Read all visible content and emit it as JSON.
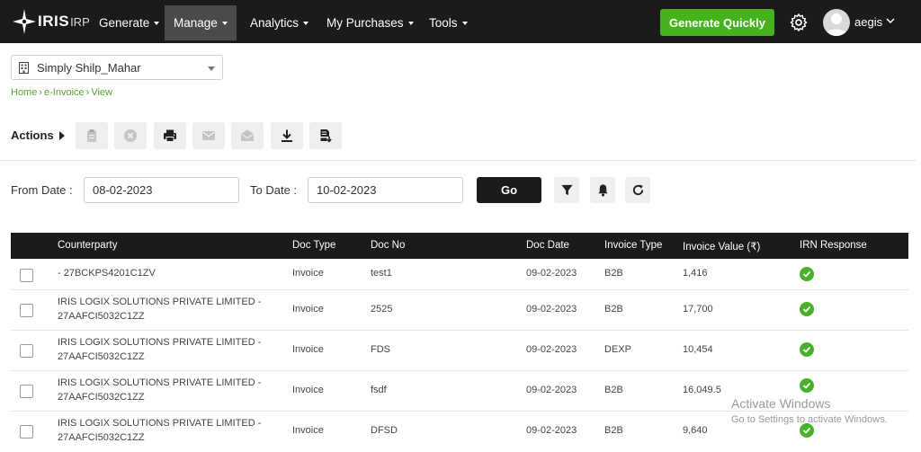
{
  "brand": {
    "name": "IRIS",
    "suffix": "IRP"
  },
  "nav": [
    {
      "label": "Generate"
    },
    {
      "label": "Manage"
    },
    {
      "label": "Analytics"
    },
    {
      "label": "My Purchases"
    },
    {
      "label": "Tools"
    }
  ],
  "header": {
    "cta_label": "Generate Quickly",
    "user_name": "aegis"
  },
  "company": {
    "selected": "Simply Shilp_Mahar"
  },
  "breadcrumb": {
    "home": "Home",
    "sep1": "›",
    "einvoice": "e-Invoice",
    "sep2": "›",
    "view": "View"
  },
  "actions": {
    "label": "Actions"
  },
  "filters": {
    "from_label": "From Date :",
    "from_value": "08-02-2023",
    "to_label": "To Date :",
    "to_value": "10-02-2023",
    "go_label": "Go"
  },
  "table": {
    "columns": [
      "Counterparty",
      "Doc Type",
      "Doc No",
      "Doc Date",
      "Invoice Type",
      "Invoice Value (₹)",
      "IRN Response"
    ],
    "rows": [
      {
        "cp1": "- 27BCKPS4201C1ZV",
        "cp2": "",
        "doc_type": "Invoice",
        "doc_no": "test1",
        "doc_date": "09-02-2023",
        "inv_type": "B2B",
        "inv_value": "1,416"
      },
      {
        "cp1": "IRIS LOGIX SOLUTIONS PRIVATE LIMITED -",
        "cp2": "27AAFCI5032C1ZZ",
        "doc_type": "Invoice",
        "doc_no": "2525",
        "doc_date": "09-02-2023",
        "inv_type": "B2B",
        "inv_value": "17,700"
      },
      {
        "cp1": "IRIS LOGIX SOLUTIONS PRIVATE LIMITED -",
        "cp2": "27AAFCI5032C1ZZ",
        "doc_type": "Invoice",
        "doc_no": "FDS",
        "doc_date": "09-02-2023",
        "inv_type": "DEXP",
        "inv_value": "10,454"
      },
      {
        "cp1": "IRIS LOGIX SOLUTIONS PRIVATE LIMITED -",
        "cp2": "27AAFCI5032C1ZZ",
        "doc_type": "Invoice",
        "doc_no": "fsdf",
        "doc_date": "09-02-2023",
        "inv_type": "B2B",
        "inv_value": "16,049.5"
      },
      {
        "cp1": "IRIS LOGIX SOLUTIONS PRIVATE LIMITED -",
        "cp2": "27AAFCI5032C1ZZ",
        "doc_type": "Invoice",
        "doc_no": "DFSD",
        "doc_date": "09-02-2023",
        "inv_type": "B2B",
        "inv_value": "9,640"
      }
    ]
  },
  "watermark": {
    "line1": "Activate Windows",
    "line2": "Go to Settings to activate Windows."
  },
  "colors": {
    "brand_green": "#46b31c",
    "nav_bg": "#1b1b1b",
    "link_green": "#56a137",
    "status_green": "#47b12a"
  }
}
